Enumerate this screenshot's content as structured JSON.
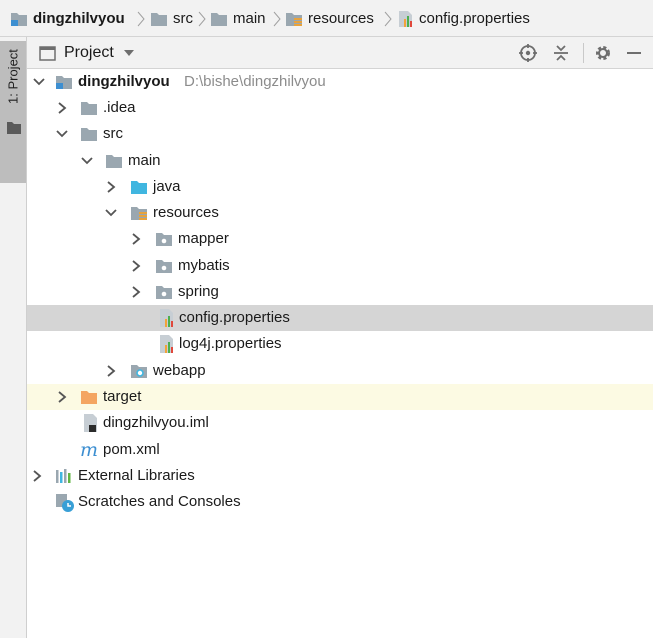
{
  "breadcrumb": {
    "items": [
      {
        "label": "dingzhilvyou",
        "icon": "project-folder-icon"
      },
      {
        "label": "src",
        "icon": "folder-icon"
      },
      {
        "label": "main",
        "icon": "folder-icon"
      },
      {
        "label": "resources",
        "icon": "resources-folder-icon"
      },
      {
        "label": "config.properties",
        "icon": "properties-file-icon"
      }
    ]
  },
  "sidebar": {
    "tab_label": "1: Project"
  },
  "toolbar": {
    "view_label": "Project",
    "icons": [
      "locate-icon",
      "collapse-all-icon",
      "gear-icon",
      "hide-icon"
    ]
  },
  "tree": {
    "rows": [
      {
        "label": "dingzhilvyou",
        "path": "D:\\bishe\\dingzhilvyou",
        "icon": "project-folder-icon",
        "arrow": "down"
      },
      {
        "label": ".idea",
        "icon": "folder-icon",
        "arrow": "right"
      },
      {
        "label": "src",
        "icon": "folder-icon",
        "arrow": "down"
      },
      {
        "label": "main",
        "icon": "folder-icon",
        "arrow": "down"
      },
      {
        "label": "java",
        "icon": "source-folder-icon",
        "arrow": "right"
      },
      {
        "label": "resources",
        "icon": "resources-folder-icon",
        "arrow": "down"
      },
      {
        "label": "mapper",
        "icon": "package-folder-icon",
        "arrow": "right"
      },
      {
        "label": "mybatis",
        "icon": "package-folder-icon",
        "arrow": "right"
      },
      {
        "label": "spring",
        "icon": "package-folder-icon",
        "arrow": "right"
      },
      {
        "label": "config.properties",
        "icon": "properties-file-icon",
        "selected": true
      },
      {
        "label": "log4j.properties",
        "icon": "properties-file-icon"
      },
      {
        "label": "webapp",
        "icon": "web-folder-icon",
        "arrow": "right"
      },
      {
        "label": "target",
        "icon": "excluded-folder-icon",
        "arrow": "right",
        "excluded": true
      },
      {
        "label": "dingzhilvyou.iml",
        "icon": "iml-file-icon"
      },
      {
        "label": "pom.xml",
        "icon": "maven-icon"
      },
      {
        "label": "External Libraries",
        "icon": "libraries-icon",
        "arrow": "right"
      },
      {
        "label": "Scratches and Consoles",
        "icon": "scratches-icon"
      }
    ]
  },
  "colors": {
    "selection": "#d5d5d5",
    "excluded_row": "#fcfae3",
    "folder": "#9aa7b0",
    "source_folder": "#40b6e0",
    "excluded_folder": "#f4a561",
    "path_text": "#8c8c8c"
  }
}
